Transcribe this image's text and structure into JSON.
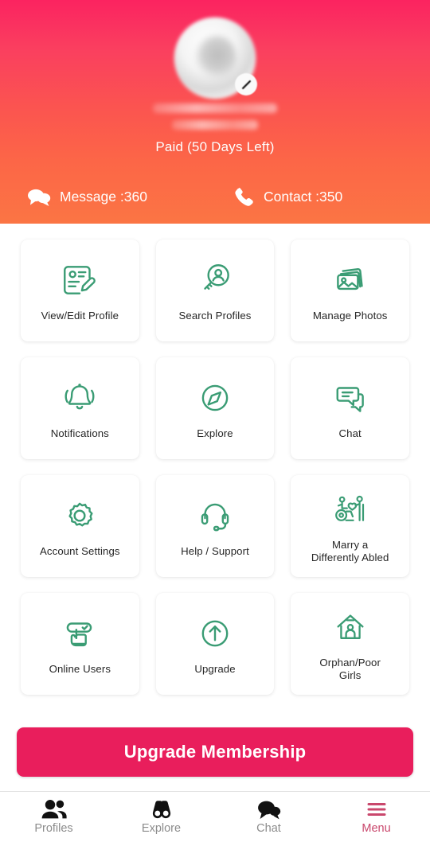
{
  "colors": {
    "gradient_top": "#fb2360",
    "gradient_bottom": "#fb7544",
    "icon_green": "#3a9c74",
    "accent_pink": "#e91e5c",
    "nav_active": "#c9476c",
    "label_dark": "#262626",
    "nav_inactive": "#8c8c8c"
  },
  "header": {
    "avatar_icon": "profile-photo-blurred",
    "avatar_edit_icon": "pencil-edit-icon",
    "name_hidden": true,
    "membership_status": "Paid (50 Days Left)",
    "stats": [
      {
        "icon": "message-bubbles-icon",
        "label": "Message :360"
      },
      {
        "icon": "phone-handset-icon",
        "label": "Contact :350"
      }
    ]
  },
  "grid": {
    "tiles": [
      {
        "icon": "profile-card-edit-icon",
        "label": "View/Edit Profile"
      },
      {
        "icon": "magnifier-person-icon",
        "label": "Search Profiles"
      },
      {
        "icon": "photo-stack-icon",
        "label": "Manage Photos"
      },
      {
        "icon": "bell-icon",
        "label": "Notifications"
      },
      {
        "icon": "compass-icon",
        "label": "Explore"
      },
      {
        "icon": "chat-bubbles-icon",
        "label": "Chat"
      },
      {
        "icon": "gear-icon",
        "label": "Account Settings"
      },
      {
        "icon": "headset-support-icon",
        "label": "Help / Support"
      },
      {
        "icon": "wheelchair-couple-icon",
        "label": "Marry a\nDifferently Abled"
      },
      {
        "icon": "hand-tap-toggle-icon",
        "label": "Online Users"
      },
      {
        "icon": "arrow-up-circle-icon",
        "label": "Upgrade"
      },
      {
        "icon": "house-person-icon",
        "label": "Orphan/Poor\nGirls"
      }
    ]
  },
  "upgrade": {
    "label": "Upgrade Membership"
  },
  "bottom_nav": {
    "items": [
      {
        "icon": "people-icon",
        "label": "Profiles",
        "active": false
      },
      {
        "icon": "binoculars-icon",
        "label": "Explore",
        "active": false
      },
      {
        "icon": "chat-bubble-icon",
        "label": "Chat",
        "active": false
      },
      {
        "icon": "hamburger-menu-icon",
        "label": "Menu",
        "active": true
      }
    ]
  }
}
